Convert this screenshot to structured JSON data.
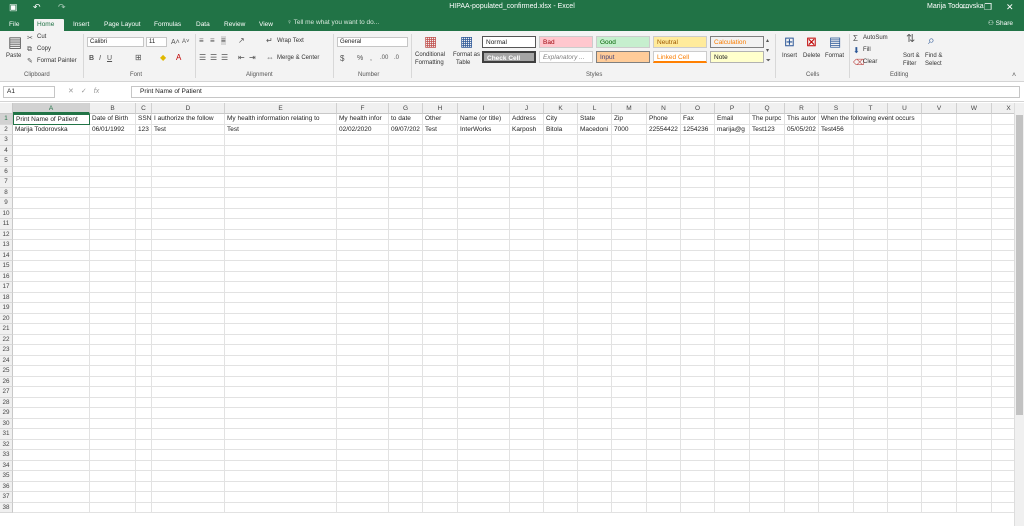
{
  "titlebar": {
    "document": "HIPAA-populated_confirmed.xlsx - Excel",
    "user": "Marija Todorovska",
    "save_icon": "save-icon",
    "undo_icon": "undo-icon",
    "redo_icon": "redo-icon"
  },
  "tabs": [
    "File",
    "Home",
    "Insert",
    "Page Layout",
    "Formulas",
    "Data",
    "Review",
    "View"
  ],
  "tell_me": "Tell me what you want to do...",
  "share": "Share",
  "ribbon": {
    "clipboard": {
      "paste": "Paste",
      "cut": "Cut",
      "copy": "Copy",
      "format_painter": "Format Painter",
      "label": "Clipboard"
    },
    "font": {
      "name": "Calibri",
      "size": "11",
      "label": "Font"
    },
    "alignment": {
      "wrap": "Wrap Text",
      "merge": "Merge & Center",
      "label": "Alignment"
    },
    "number": {
      "format": "General",
      "label": "Number"
    },
    "styles": {
      "conditional": [
        "Conditional",
        "Formatting"
      ],
      "format_table": [
        "Format as",
        "Table"
      ],
      "items": [
        "Normal",
        "Bad",
        "Good",
        "Neutral",
        "Calculation",
        "Check Cell",
        "Explanatory ...",
        "Input",
        "Linked Cell",
        "Note"
      ],
      "label": "Styles"
    },
    "cells": {
      "insert": "Insert",
      "delete": "Delete",
      "format": "Format",
      "label": "Cells"
    },
    "editing": {
      "autosum": "AutoSum",
      "fill": "Fill",
      "clear": "Clear",
      "sort": [
        "Sort &",
        "Filter"
      ],
      "find": [
        "Find &",
        "Select"
      ],
      "label": "Editing"
    }
  },
  "formula_bar": {
    "name_box": "A1",
    "fx": "fx",
    "content": "Print Name of Patient"
  },
  "grid": {
    "columns": [
      "A",
      "B",
      "C",
      "D",
      "E",
      "F",
      "G",
      "H",
      "I",
      "J",
      "K",
      "L",
      "M",
      "N",
      "O",
      "P",
      "Q",
      "R",
      "S",
      "T",
      "U",
      "V",
      "W",
      "X"
    ],
    "row_count": 38,
    "row1": [
      "Print Name of Patient",
      "Date of Birth",
      "SSN",
      "I authorize the follow",
      "My health information relating to",
      "My health infor",
      "to date",
      "Other",
      "Name (or title)",
      "Address",
      "City",
      "State",
      "Zip",
      "Phone",
      "Fax",
      "Email",
      "The purpc",
      "This autor",
      "When the following event occurs",
      "",
      "",
      "",
      "",
      ""
    ],
    "row2": [
      "Marija Todorovska",
      "06/01/1992",
      "123",
      "Test",
      "Test",
      "02/02/2020",
      "09/07/202",
      "Test",
      "InterWorks",
      "Karposh",
      "Bitola",
      "Macedoni",
      "7000",
      "22554422",
      "1254236",
      "marija@g",
      "Test123",
      "05/05/202",
      "Test456",
      "",
      "",
      "",
      "",
      ""
    ]
  },
  "colors": {
    "accent": "#217346",
    "bad": "#ffc7ce",
    "good": "#c6efce",
    "neutral": "#ffeb9c",
    "input": "#ffcc99",
    "check": "#a5a5a5"
  }
}
